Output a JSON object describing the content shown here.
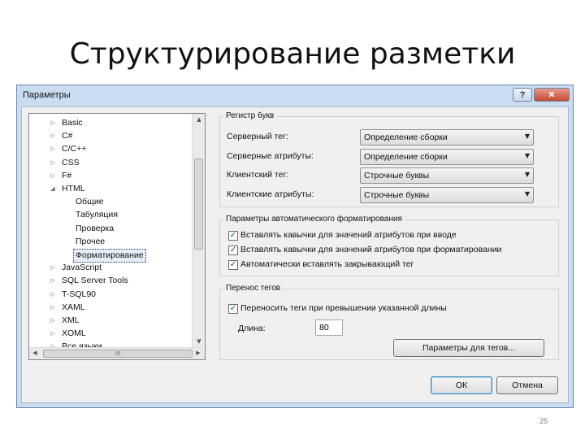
{
  "slide": {
    "title": "Структурирование разметки",
    "page_number": "25"
  },
  "dialog": {
    "title": "Параметры",
    "help_label": "?",
    "close_label": "✕"
  },
  "tree": {
    "items": [
      {
        "label": "Basic",
        "arrow": "▷"
      },
      {
        "label": "C#",
        "arrow": "▷"
      },
      {
        "label": "C/C++",
        "arrow": "▷"
      },
      {
        "label": "CSS",
        "arrow": "▷"
      },
      {
        "label": "F#",
        "arrow": "▷"
      },
      {
        "label": "HTML",
        "arrow": "◢"
      },
      {
        "label": "Общие",
        "arrow": ""
      },
      {
        "label": "Табуляция",
        "arrow": ""
      },
      {
        "label": "Проверка",
        "arrow": ""
      },
      {
        "label": "Прочее",
        "arrow": ""
      },
      {
        "label": "Форматирование",
        "arrow": ""
      },
      {
        "label": "JavaScript",
        "arrow": "▷"
      },
      {
        "label": "SQL Server Tools",
        "arrow": "▷"
      },
      {
        "label": "T-SQL90",
        "arrow": "▷"
      },
      {
        "label": "XAML",
        "arrow": "▷"
      },
      {
        "label": "XML",
        "arrow": "▷"
      },
      {
        "label": "XOML",
        "arrow": "▷"
      },
      {
        "label": "Все языки",
        "arrow": "▷"
      }
    ],
    "scroll_grip": "III"
  },
  "case_group": {
    "title": "Регистр букв",
    "rows": [
      {
        "label": "Серверный тег:",
        "value": "Определение сборки"
      },
      {
        "label": "Серверные атрибуты:",
        "value": "Определение сборки"
      },
      {
        "label": "Клиентский тег:",
        "value": "Строчные буквы"
      },
      {
        "label": "Клиентские атрибуты:",
        "value": "Строчные буквы"
      }
    ]
  },
  "autoformat_group": {
    "title": "Параметры автоматического форматирования",
    "checks": [
      {
        "label": "Вставлять кавычки для значений атрибутов при вводе",
        "checked": true
      },
      {
        "label": "Вставлять кавычки для значений атрибутов при форматировании",
        "checked": true
      },
      {
        "label": "Автоматически вставлять закрывающий тег",
        "checked": true
      }
    ]
  },
  "wrap_group": {
    "title": "Перенос тегов",
    "check_label": "Переносить теги при превышении указанной длины",
    "checked": true,
    "length_label": "Длина:",
    "length_value": "80",
    "tag_params_button": "Параметры для тегов..."
  },
  "footer": {
    "ok_label": "ОК",
    "cancel_label": "Отмена"
  }
}
